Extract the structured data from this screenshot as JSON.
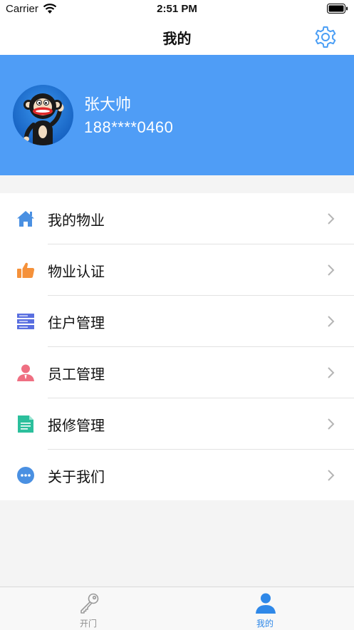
{
  "status_bar": {
    "carrier": "Carrier",
    "time": "2:51 PM"
  },
  "nav": {
    "title": "我的",
    "settings_icon": "gear-icon"
  },
  "profile": {
    "name": "张大帅",
    "phone": "188****0460",
    "background_color": "#4f9df6"
  },
  "menu": {
    "items": [
      {
        "label": "我的物业",
        "icon": "home-icon",
        "color": "#4a90e2"
      },
      {
        "label": "物业认证",
        "icon": "thumbs-up-icon",
        "color": "#f5913a"
      },
      {
        "label": "住户管理",
        "icon": "list-icon",
        "color": "#5a6fe0"
      },
      {
        "label": "员工管理",
        "icon": "person-icon",
        "color": "#ef6f82"
      },
      {
        "label": "报修管理",
        "icon": "document-icon",
        "color": "#2bbf9c"
      },
      {
        "label": "关于我们",
        "icon": "more-icon",
        "color": "#4a90e2"
      }
    ]
  },
  "tabbar": {
    "tabs": [
      {
        "label": "开门",
        "icon": "key-icon",
        "active": false
      },
      {
        "label": "我的",
        "icon": "user-icon",
        "active": true
      }
    ],
    "active_color": "#2f88e8",
    "inactive_color": "#8e8e8e"
  }
}
